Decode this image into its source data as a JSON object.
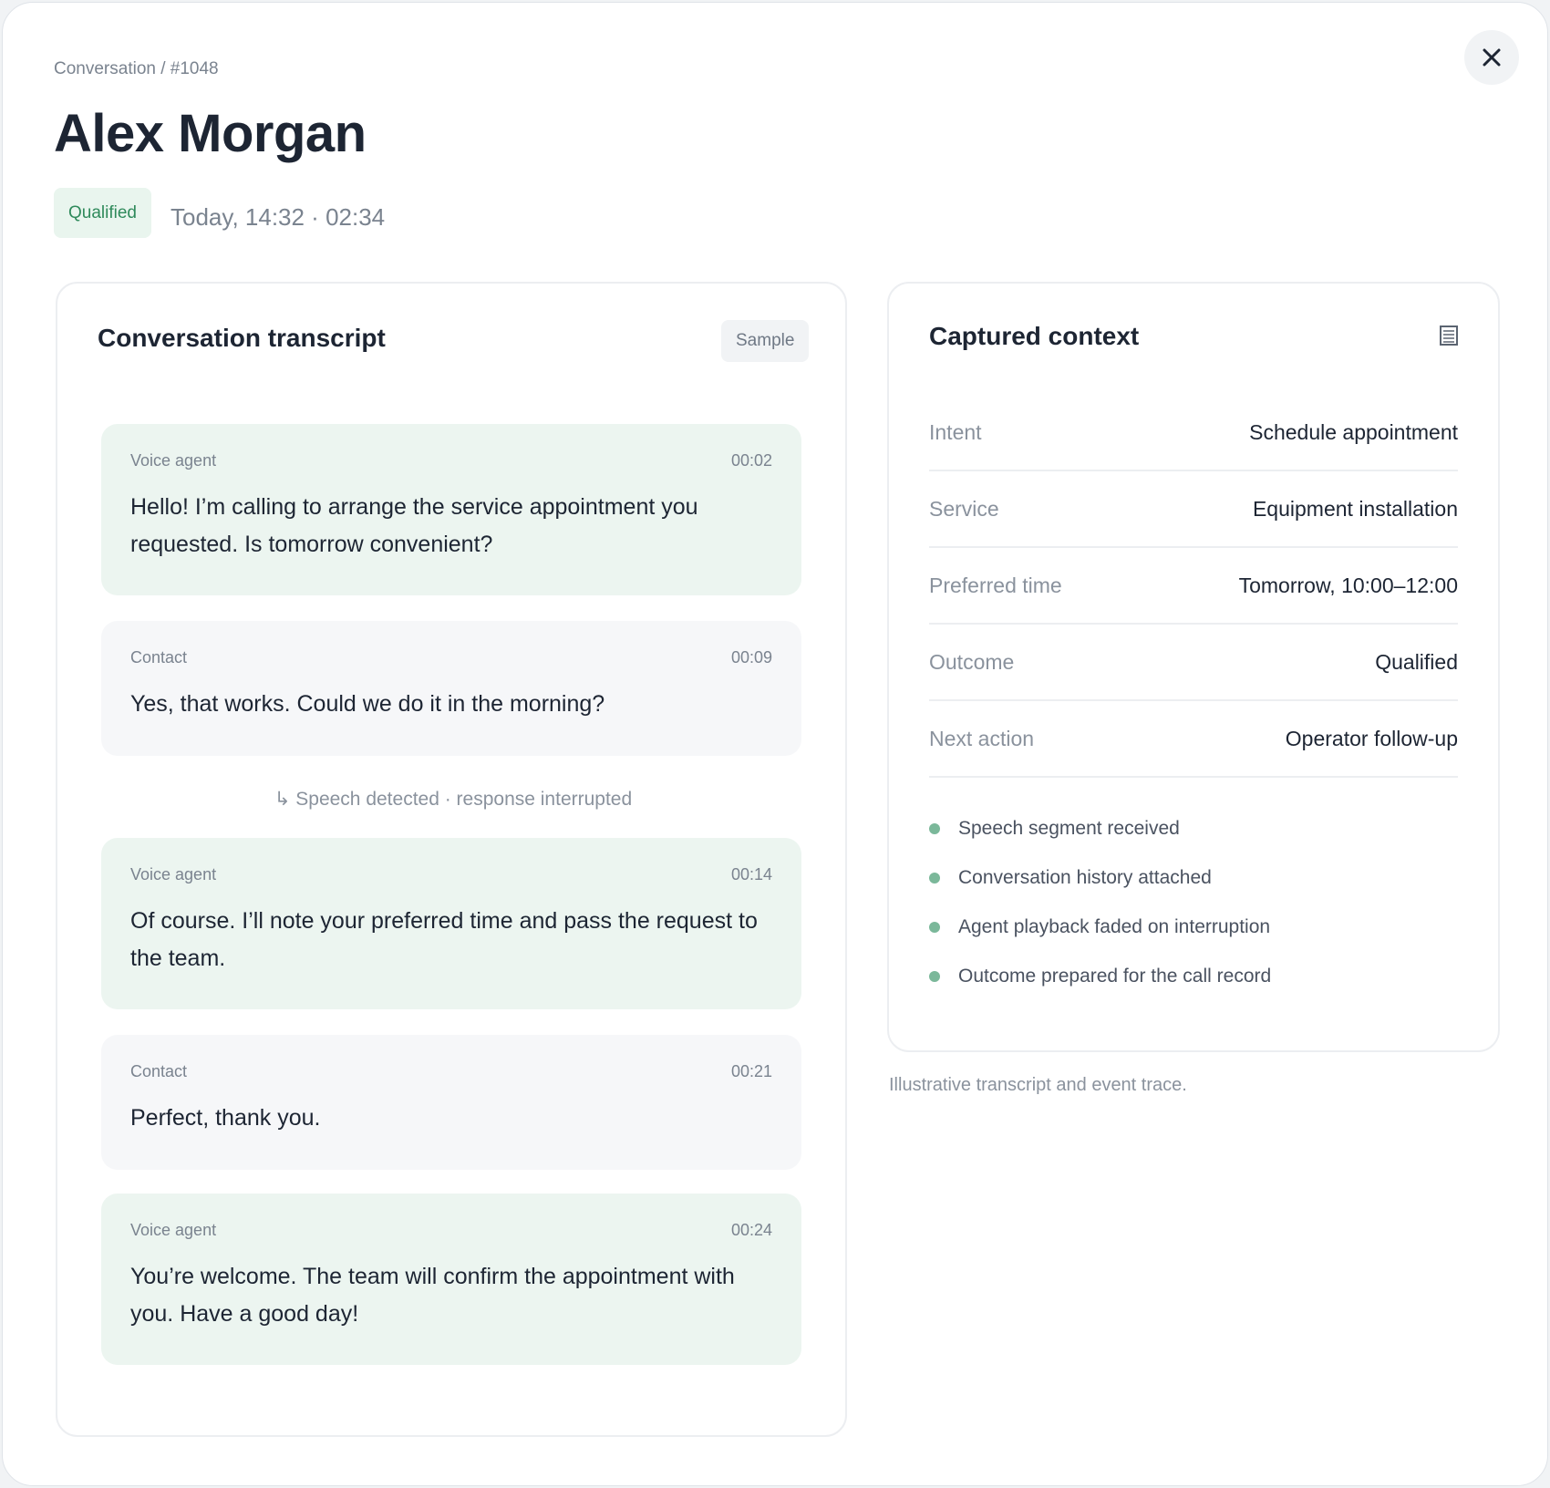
{
  "header": {
    "breadcrumb": "Conversation / #1048",
    "title": "Alex Morgan",
    "status": "Qualified",
    "meta": "Today, 14:32 · 02:34"
  },
  "transcript": {
    "title": "Conversation transcript",
    "tag": "Sample",
    "messages": [
      {
        "speaker": "Voice agent",
        "time": "00:02",
        "text": "Hello! I’m calling to arrange the service appointment you requested. Is tomorrow convenient?"
      },
      {
        "speaker": "Contact",
        "time": "00:09",
        "text": "Yes, that works. Could we do it in the morning?"
      },
      {
        "speaker": "Voice agent",
        "time": "00:14",
        "text": "Of course. I’ll note your preferred time and pass the request to the team."
      },
      {
        "speaker": "Contact",
        "time": "00:21",
        "text": "Perfect, thank you."
      },
      {
        "speaker": "Voice agent",
        "time": "00:24",
        "text": "You’re welcome. The team will confirm the appointment with you. Have a good day!"
      }
    ],
    "interruption": "↳ Speech detected · response interrupted"
  },
  "context": {
    "title": "Captured context",
    "fields": [
      {
        "label": "Intent",
        "value": "Schedule appointment"
      },
      {
        "label": "Service",
        "value": "Equipment installation"
      },
      {
        "label": "Preferred time",
        "value": "Tomorrow, 10:00–12:00"
      },
      {
        "label": "Outcome",
        "value": "Qualified"
      },
      {
        "label": "Next action",
        "value": "Operator follow-up"
      }
    ],
    "events": [
      "Speech segment received",
      "Conversation history attached",
      "Agent playback faded on interruption",
      "Outcome prepared for the call record"
    ]
  },
  "footnote": "Illustrative transcript and event trace.",
  "colors": {
    "accent": "#2f8a5b",
    "agent_bubble": "#ecf5f0",
    "contact_bubble": "#f6f7f9",
    "event_dot": "#7bb89a"
  }
}
